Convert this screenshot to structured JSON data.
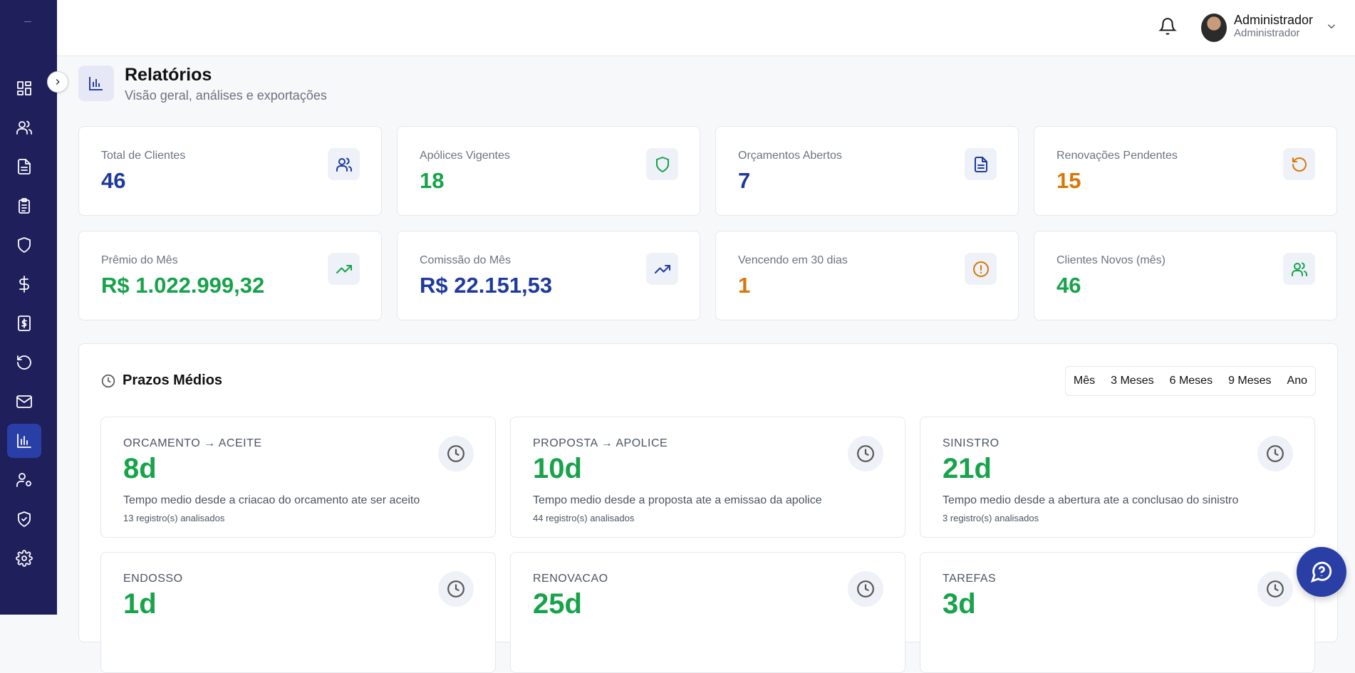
{
  "header": {
    "user_name": "Administrador",
    "user_role": "Administrador"
  },
  "page": {
    "title": "Relatórios",
    "subtitle": "Visão geral, análises e exportações"
  },
  "sidebar": {
    "items": [
      {
        "name": "dashboard-icon"
      },
      {
        "name": "clients-icon"
      },
      {
        "name": "document-icon"
      },
      {
        "name": "clipboard-icon"
      },
      {
        "name": "shield-icon"
      },
      {
        "name": "dollar-icon"
      },
      {
        "name": "invoice-icon"
      },
      {
        "name": "renew-icon"
      },
      {
        "name": "mail-icon"
      },
      {
        "name": "reports-icon",
        "active": true
      },
      {
        "name": "user-settings-icon"
      },
      {
        "name": "shield-check-icon"
      },
      {
        "name": "gear-icon"
      }
    ]
  },
  "stats": [
    {
      "label": "Total de Clientes",
      "value": "46",
      "color": "#1e3a9e"
    },
    {
      "label": "Apólices Vigentes",
      "value": "18",
      "color": "#16a34a"
    },
    {
      "label": "Orçamentos Abertos",
      "value": "7",
      "color": "#1e3a9e"
    },
    {
      "label": "Renovações Pendentes",
      "value": "15",
      "color": "#d97706"
    },
    {
      "label": "Prêmio do Mês",
      "value": "R$ 1.022.999,32",
      "color": "#16a34a"
    },
    {
      "label": "Comissão do Mês",
      "value": "R$ 22.151,53",
      "color": "#1e3a9e"
    },
    {
      "label": "Vencendo em 30 dias",
      "value": "1",
      "color": "#d97706"
    },
    {
      "label": "Clientes Novos (mês)",
      "value": "46",
      "color": "#16a34a"
    }
  ],
  "prazos": {
    "title": "Prazos Médios",
    "periods": [
      "Mês",
      "3 Meses",
      "6 Meses",
      "9 Meses",
      "Ano"
    ],
    "cards": [
      {
        "title": "ORCAMENTO → ACEITE",
        "value": "8d",
        "desc": "Tempo medio desde a criacao do orcamento ate ser aceito",
        "count": "13 registro(s) analisados"
      },
      {
        "title": "PROPOSTA → APOLICE",
        "value": "10d",
        "desc": "Tempo medio desde a proposta ate a emissao da apolice",
        "count": "44 registro(s) analisados"
      },
      {
        "title": "SINISTRO",
        "value": "21d",
        "desc": "Tempo medio desde a abertura ate a conclusao do sinistro",
        "count": "3 registro(s) analisados"
      },
      {
        "title": "ENDOSSO",
        "value": "1d"
      },
      {
        "title": "RENOVACAO",
        "value": "25d"
      },
      {
        "title": "TAREFAS",
        "value": "3d"
      }
    ]
  }
}
